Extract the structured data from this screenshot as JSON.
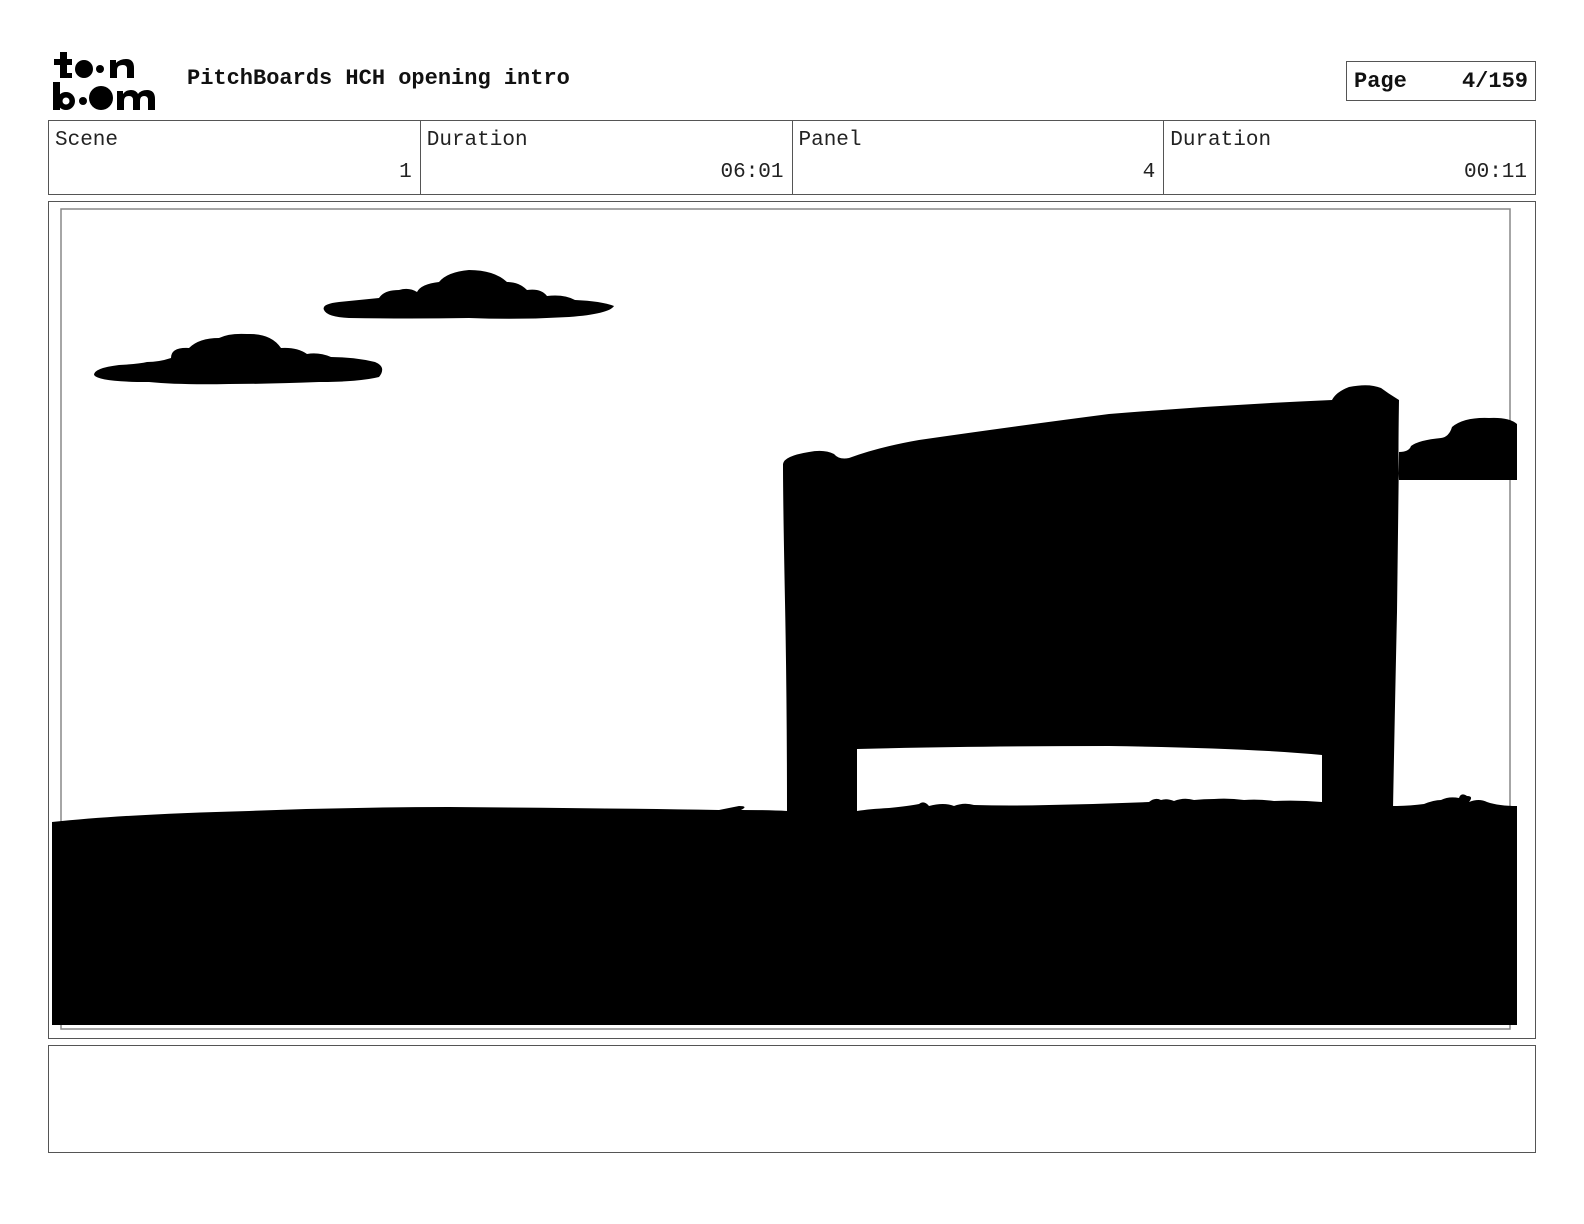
{
  "header": {
    "logo_text": "toon boom",
    "title": "PitchBoards HCH opening intro",
    "page_label": "Page",
    "page_value": "4/159"
  },
  "info": [
    {
      "label": "Scene",
      "value": "1"
    },
    {
      "label": "Duration",
      "value": "06:01"
    },
    {
      "label": "Panel",
      "value": "4"
    },
    {
      "label": "Duration",
      "value": "00:11"
    }
  ],
  "panel": {
    "content": "silhouette-sky-clouds-billboard-ground"
  },
  "notes": {
    "text": ""
  },
  "colors": {
    "silhouette": "#000000",
    "border": "#555555",
    "background": "#ffffff"
  }
}
